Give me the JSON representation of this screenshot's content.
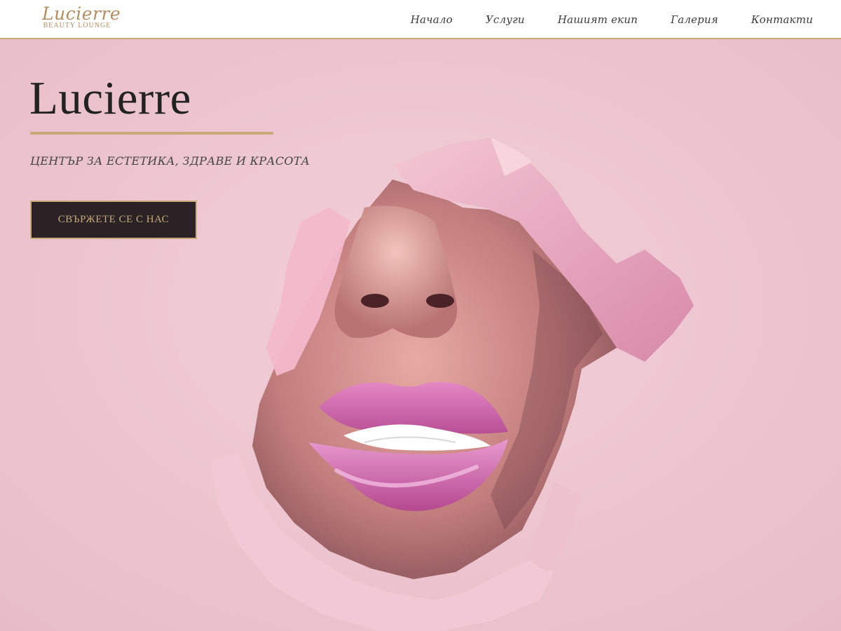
{
  "logo": {
    "name": "Lucierre",
    "tagline": "BEAUTY LOUNGE"
  },
  "nav": {
    "items": [
      "Начало",
      "Услуги",
      "Нашият екип",
      "Галерия",
      "Контакти"
    ]
  },
  "hero": {
    "title": "Lucierre",
    "subtitle": "ЦЕНТЪР ЗА ЕСТЕТИКА, ЗДРАВЕ И КРАСОТА",
    "cta_label": "СВЪРЖЕТЕ СЕ С НАС"
  },
  "colors": {
    "accent_gold": "#c8a979",
    "background_pink": "#efc9d3",
    "button_dark": "#2a2224",
    "lip_pink": "#d05fa8"
  }
}
